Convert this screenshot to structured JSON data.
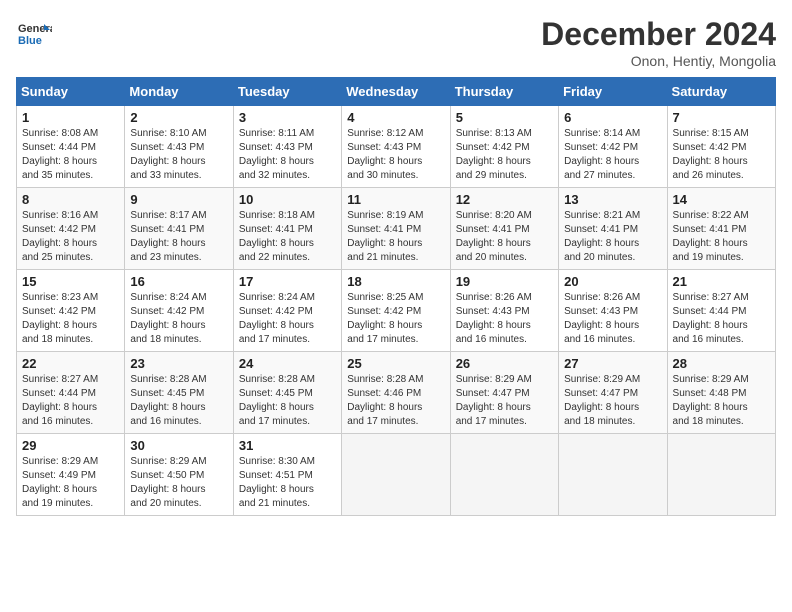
{
  "header": {
    "logo_line1": "General",
    "logo_line2": "Blue",
    "title": "December 2024",
    "subtitle": "Onon, Hentiy, Mongolia"
  },
  "columns": [
    "Sunday",
    "Monday",
    "Tuesday",
    "Wednesday",
    "Thursday",
    "Friday",
    "Saturday"
  ],
  "weeks": [
    [
      {
        "day": "1",
        "info": "Sunrise: 8:08 AM\nSunset: 4:44 PM\nDaylight: 8 hours\nand 35 minutes."
      },
      {
        "day": "2",
        "info": "Sunrise: 8:10 AM\nSunset: 4:43 PM\nDaylight: 8 hours\nand 33 minutes."
      },
      {
        "day": "3",
        "info": "Sunrise: 8:11 AM\nSunset: 4:43 PM\nDaylight: 8 hours\nand 32 minutes."
      },
      {
        "day": "4",
        "info": "Sunrise: 8:12 AM\nSunset: 4:43 PM\nDaylight: 8 hours\nand 30 minutes."
      },
      {
        "day": "5",
        "info": "Sunrise: 8:13 AM\nSunset: 4:42 PM\nDaylight: 8 hours\nand 29 minutes."
      },
      {
        "day": "6",
        "info": "Sunrise: 8:14 AM\nSunset: 4:42 PM\nDaylight: 8 hours\nand 27 minutes."
      },
      {
        "day": "7",
        "info": "Sunrise: 8:15 AM\nSunset: 4:42 PM\nDaylight: 8 hours\nand 26 minutes."
      }
    ],
    [
      {
        "day": "8",
        "info": "Sunrise: 8:16 AM\nSunset: 4:42 PM\nDaylight: 8 hours\nand 25 minutes."
      },
      {
        "day": "9",
        "info": "Sunrise: 8:17 AM\nSunset: 4:41 PM\nDaylight: 8 hours\nand 23 minutes."
      },
      {
        "day": "10",
        "info": "Sunrise: 8:18 AM\nSunset: 4:41 PM\nDaylight: 8 hours\nand 22 minutes."
      },
      {
        "day": "11",
        "info": "Sunrise: 8:19 AM\nSunset: 4:41 PM\nDaylight: 8 hours\nand 21 minutes."
      },
      {
        "day": "12",
        "info": "Sunrise: 8:20 AM\nSunset: 4:41 PM\nDaylight: 8 hours\nand 20 minutes."
      },
      {
        "day": "13",
        "info": "Sunrise: 8:21 AM\nSunset: 4:41 PM\nDaylight: 8 hours\nand 20 minutes."
      },
      {
        "day": "14",
        "info": "Sunrise: 8:22 AM\nSunset: 4:41 PM\nDaylight: 8 hours\nand 19 minutes."
      }
    ],
    [
      {
        "day": "15",
        "info": "Sunrise: 8:23 AM\nSunset: 4:42 PM\nDaylight: 8 hours\nand 18 minutes."
      },
      {
        "day": "16",
        "info": "Sunrise: 8:24 AM\nSunset: 4:42 PM\nDaylight: 8 hours\nand 18 minutes."
      },
      {
        "day": "17",
        "info": "Sunrise: 8:24 AM\nSunset: 4:42 PM\nDaylight: 8 hours\nand 17 minutes."
      },
      {
        "day": "18",
        "info": "Sunrise: 8:25 AM\nSunset: 4:42 PM\nDaylight: 8 hours\nand 17 minutes."
      },
      {
        "day": "19",
        "info": "Sunrise: 8:26 AM\nSunset: 4:43 PM\nDaylight: 8 hours\nand 16 minutes."
      },
      {
        "day": "20",
        "info": "Sunrise: 8:26 AM\nSunset: 4:43 PM\nDaylight: 8 hours\nand 16 minutes."
      },
      {
        "day": "21",
        "info": "Sunrise: 8:27 AM\nSunset: 4:44 PM\nDaylight: 8 hours\nand 16 minutes."
      }
    ],
    [
      {
        "day": "22",
        "info": "Sunrise: 8:27 AM\nSunset: 4:44 PM\nDaylight: 8 hours\nand 16 minutes."
      },
      {
        "day": "23",
        "info": "Sunrise: 8:28 AM\nSunset: 4:45 PM\nDaylight: 8 hours\nand 16 minutes."
      },
      {
        "day": "24",
        "info": "Sunrise: 8:28 AM\nSunset: 4:45 PM\nDaylight: 8 hours\nand 17 minutes."
      },
      {
        "day": "25",
        "info": "Sunrise: 8:28 AM\nSunset: 4:46 PM\nDaylight: 8 hours\nand 17 minutes."
      },
      {
        "day": "26",
        "info": "Sunrise: 8:29 AM\nSunset: 4:47 PM\nDaylight: 8 hours\nand 17 minutes."
      },
      {
        "day": "27",
        "info": "Sunrise: 8:29 AM\nSunset: 4:47 PM\nDaylight: 8 hours\nand 18 minutes."
      },
      {
        "day": "28",
        "info": "Sunrise: 8:29 AM\nSunset: 4:48 PM\nDaylight: 8 hours\nand 18 minutes."
      }
    ],
    [
      {
        "day": "29",
        "info": "Sunrise: 8:29 AM\nSunset: 4:49 PM\nDaylight: 8 hours\nand 19 minutes."
      },
      {
        "day": "30",
        "info": "Sunrise: 8:29 AM\nSunset: 4:50 PM\nDaylight: 8 hours\nand 20 minutes."
      },
      {
        "day": "31",
        "info": "Sunrise: 8:30 AM\nSunset: 4:51 PM\nDaylight: 8 hours\nand 21 minutes."
      },
      null,
      null,
      null,
      null
    ]
  ]
}
